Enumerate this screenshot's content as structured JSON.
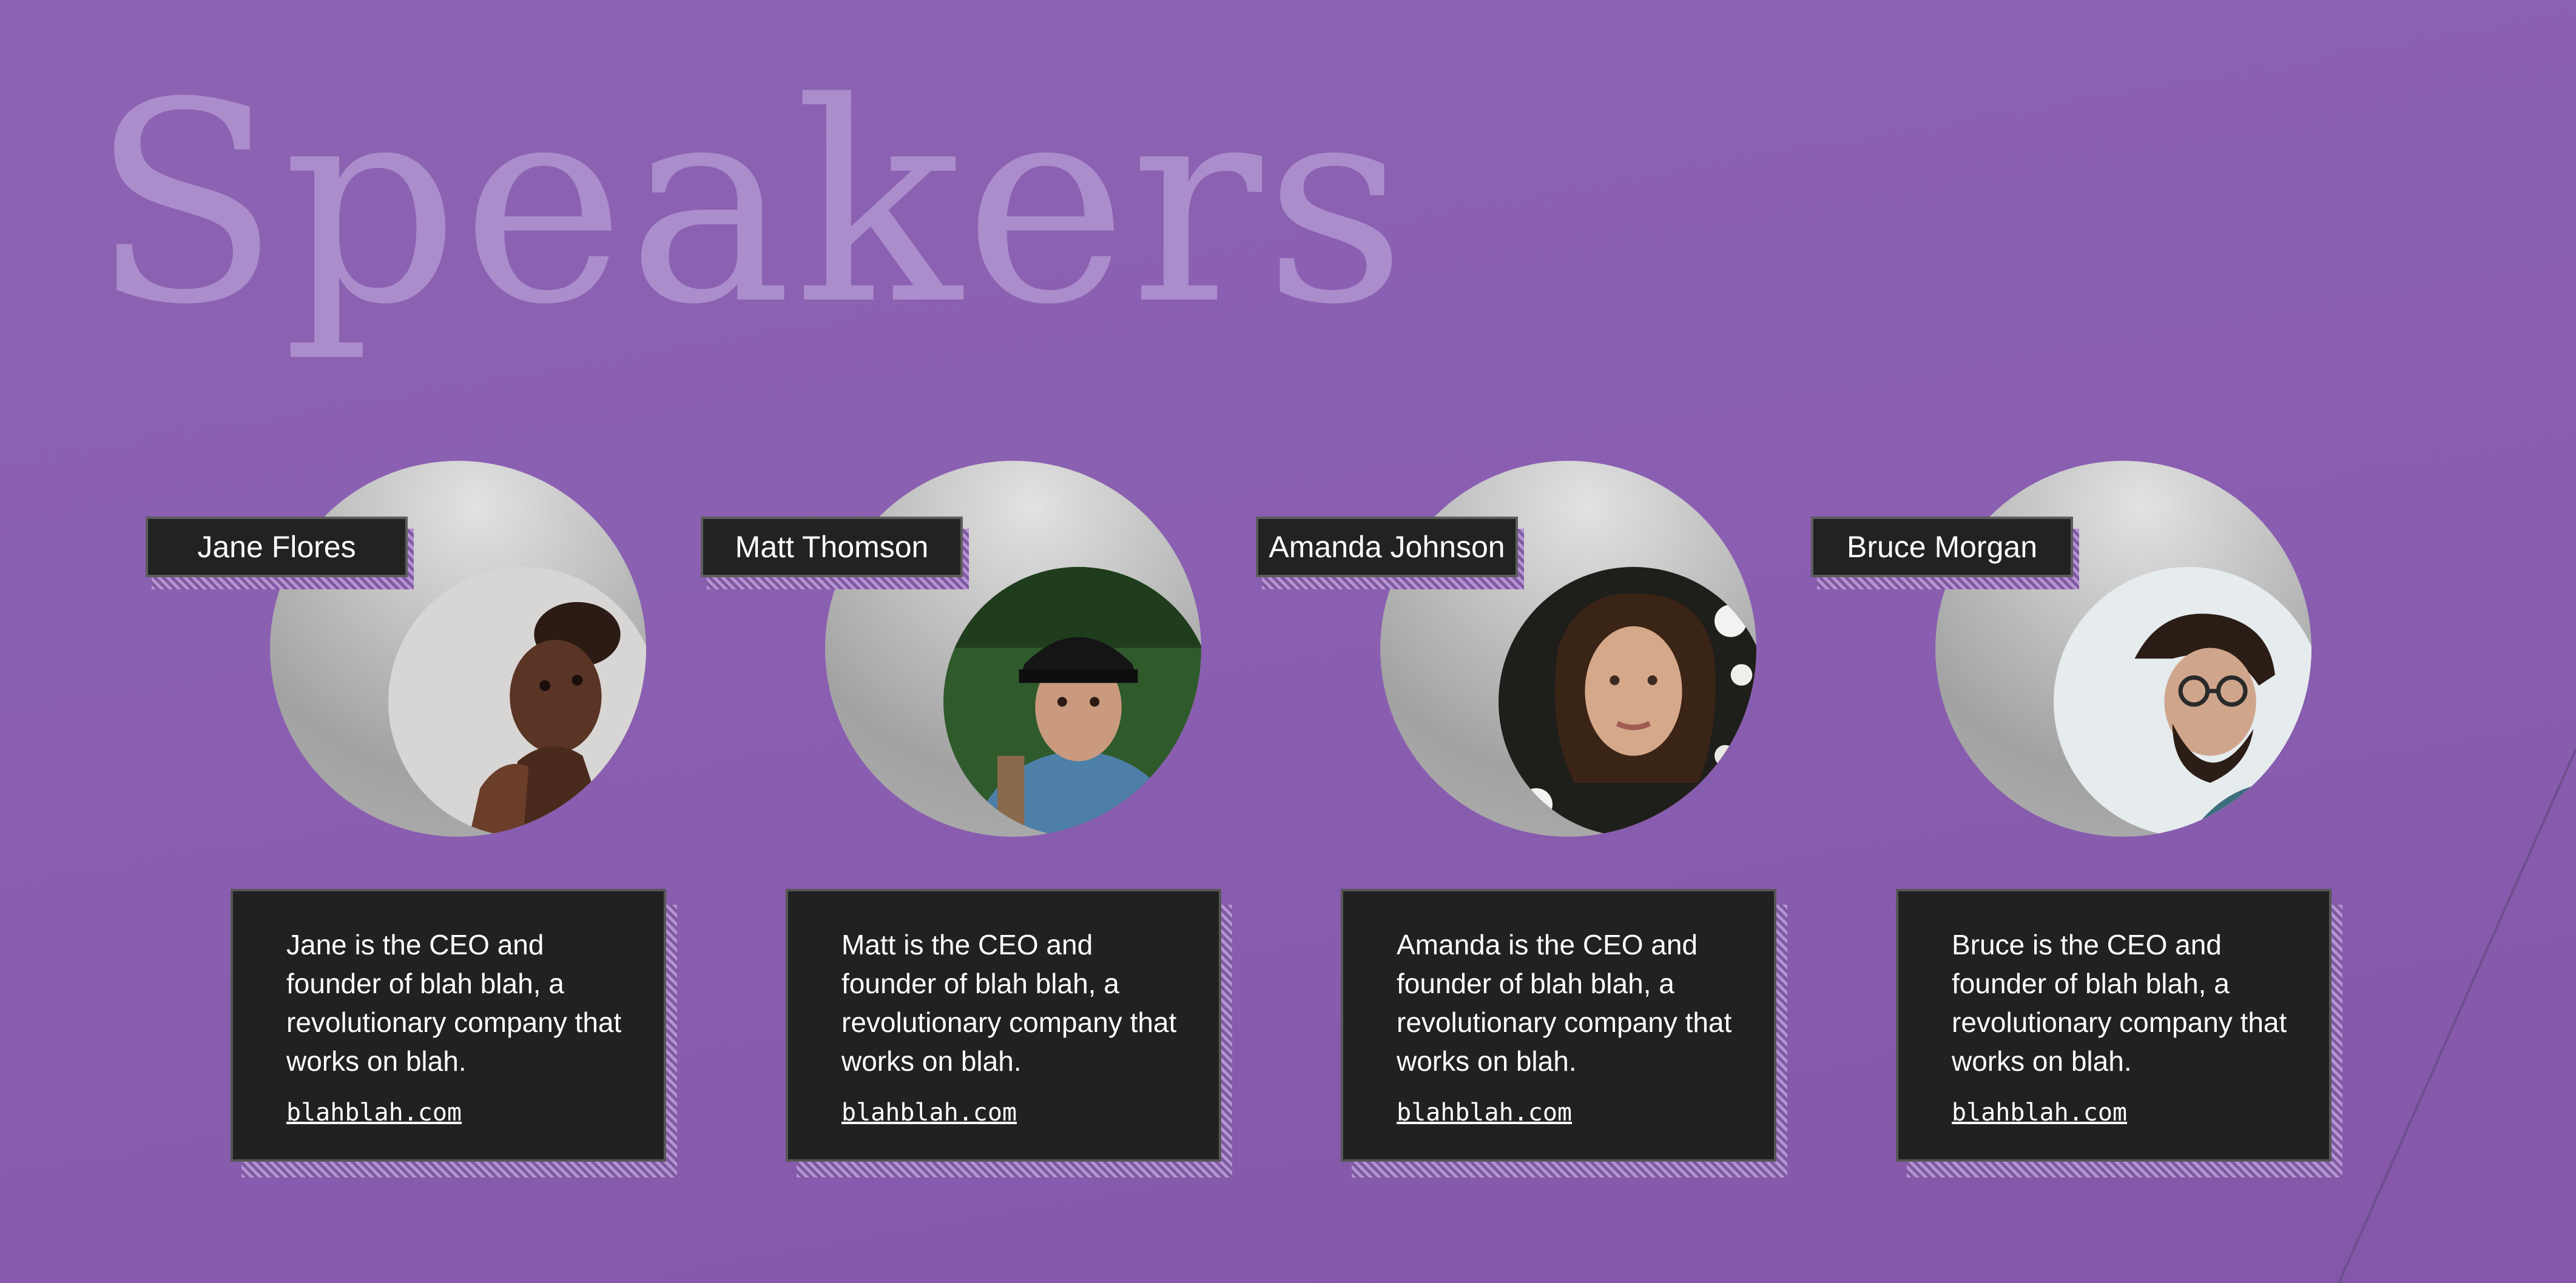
{
  "page": {
    "title": "Speakers"
  },
  "theme": {
    "background": "#8a5fb1",
    "title_color": "#ab8dcc",
    "card_color": "#212121",
    "hatch_color": "#b693d2"
  },
  "speakers": [
    {
      "name": "Jane Flores",
      "bio": "Jane is the CEO and founder of blah blah, a revolutionary company that works on blah.",
      "link": "blahblah.com",
      "photo_icon": "portrait-woman-icon"
    },
    {
      "name": "Matt Thomson",
      "bio": "Matt is the CEO and founder of blah blah, a revolutionary company that works on blah.",
      "link": "blahblah.com",
      "photo_icon": "portrait-man-cap-icon"
    },
    {
      "name": "Amanda Johnson",
      "bio": "Amanda is the CEO and founder of blah blah, a revolutionary company that works on blah.",
      "link": "blahblah.com",
      "photo_icon": "portrait-woman-flowers-icon"
    },
    {
      "name": "Bruce Morgan",
      "bio": "Bruce is the CEO and founder of blah blah, a revolutionary company that works on blah.",
      "link": "blahblah.com",
      "photo_icon": "portrait-man-glasses-icon"
    }
  ]
}
